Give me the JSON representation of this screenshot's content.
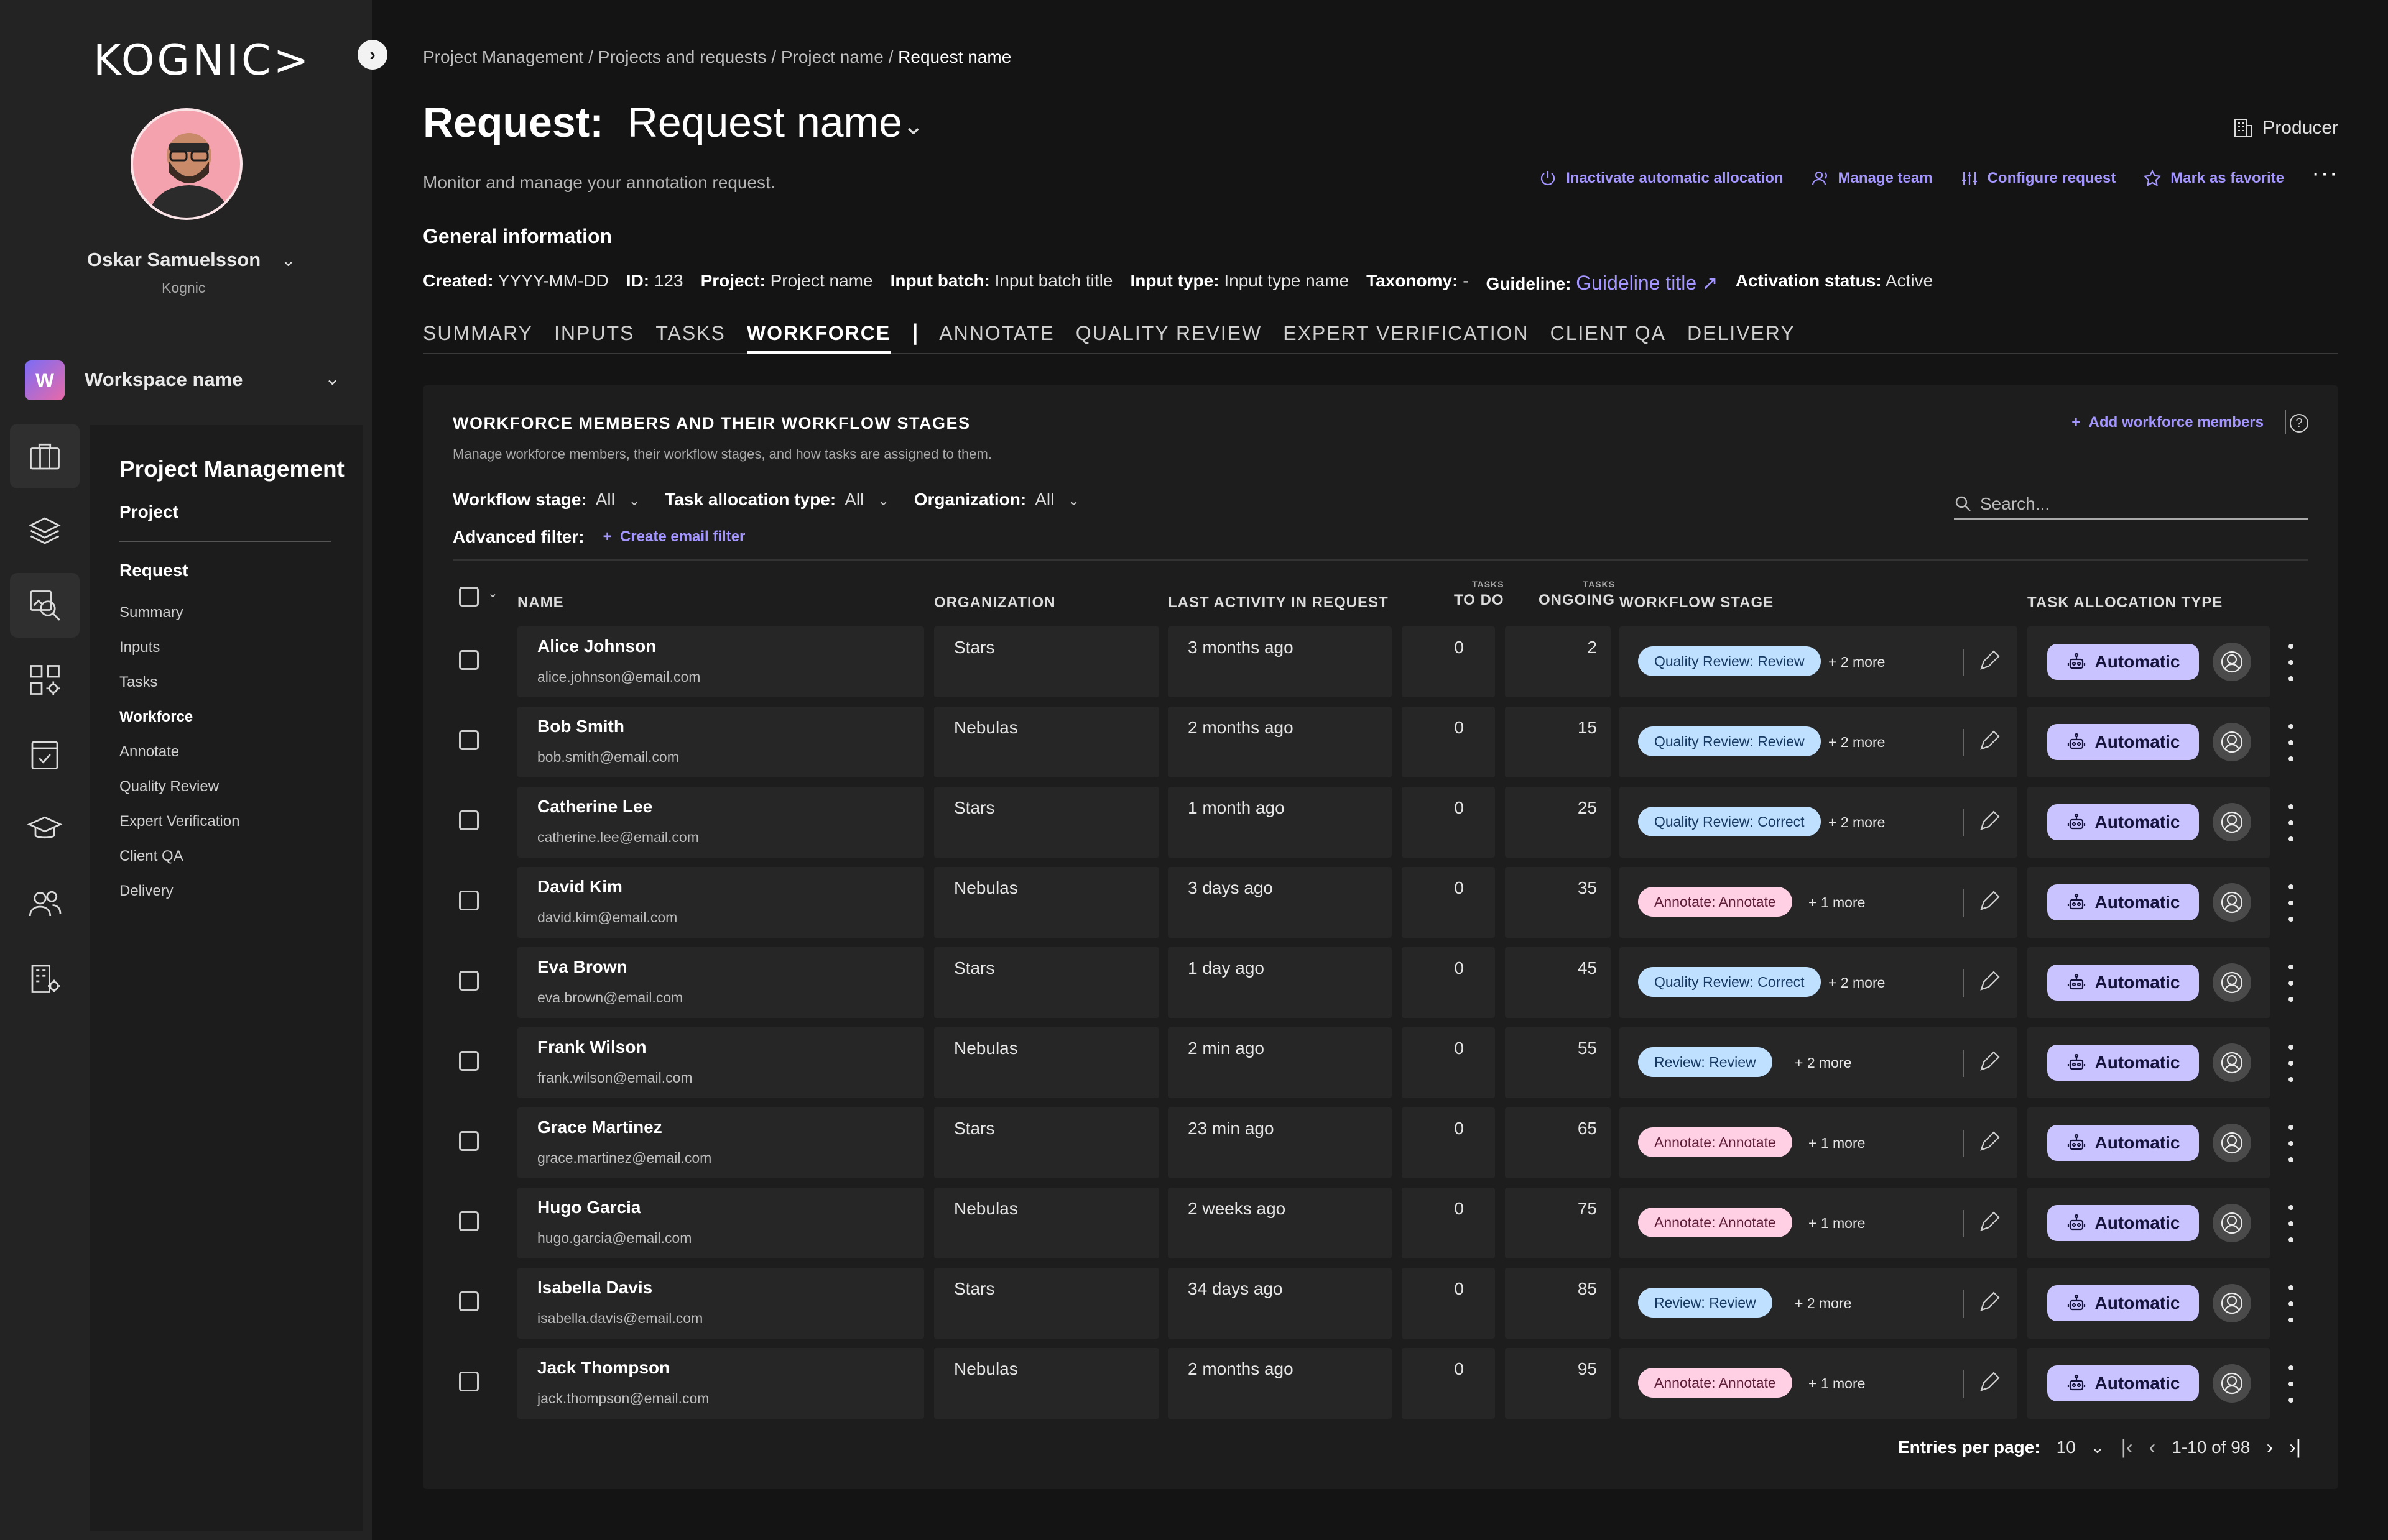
{
  "app": {
    "logo": "KOGNIC>"
  },
  "user": {
    "name": "Oskar Samuelsson",
    "org": "Kognic"
  },
  "workspace": {
    "badge": "W",
    "name": "Workspace name"
  },
  "rail_icons": [
    "briefcase-icon",
    "layers-icon",
    "search-image-icon",
    "apps-settings-icon",
    "checklist-icon",
    "graduation-cap-icon",
    "users-icon",
    "building-settings-icon"
  ],
  "subnav": {
    "title": "Project Management",
    "project": "Project",
    "request": "Request",
    "items": [
      {
        "label": "Summary",
        "active": false
      },
      {
        "label": "Inputs",
        "active": false
      },
      {
        "label": "Tasks",
        "active": false
      },
      {
        "label": "Workforce",
        "active": true
      },
      {
        "label": "Annotate",
        "active": false
      },
      {
        "label": "Quality Review",
        "active": false
      },
      {
        "label": "Expert Verification",
        "active": false
      },
      {
        "label": "Client QA",
        "active": false
      },
      {
        "label": "Delivery",
        "active": false
      }
    ]
  },
  "breadcrumb": {
    "items": [
      "Project Management",
      "Projects and requests",
      "Project name"
    ],
    "current": "Request name",
    "sep": " / "
  },
  "header": {
    "title_prefix": "Request:",
    "title": "Request name",
    "role": "Producer",
    "subtitle": "Monitor and manage your annotation request.",
    "actions": {
      "inactivate": "Inactivate automatic allocation",
      "manage_team": "Manage team",
      "configure": "Configure request",
      "favorite": "Mark as favorite"
    }
  },
  "general": {
    "title": "General information",
    "created_label": "Created:",
    "created": "YYYY-MM-DD",
    "id_label": "ID:",
    "id": "123",
    "project_label": "Project:",
    "project": "Project name",
    "batch_label": "Input batch:",
    "batch": "Input batch title",
    "type_label": "Input type:",
    "type": "Input type name",
    "taxonomy_label": "Taxonomy:",
    "taxonomy": "-",
    "guideline_label": "Guideline:",
    "guideline": "Guideline title",
    "status_label": "Activation status:",
    "status": "Active"
  },
  "tabs": {
    "summary": "SUMMARY",
    "inputs": "INPUTS",
    "tasks": "TASKS",
    "workforce": "WORKFORCE",
    "sep": "|",
    "annotate": "ANNOTATE",
    "quality_review": "QUALITY REVIEW",
    "expert_verification": "EXPERT VERIFICATION",
    "client_qa": "CLIENT QA",
    "delivery": "DELIVERY"
  },
  "card": {
    "title": "WORKFORCE MEMBERS AND THEIR WORKFLOW STAGES",
    "subtitle": "Manage workforce members, their workflow stages, and how tasks are assigned to them.",
    "add_members": "Add workforce members",
    "help": "?",
    "filters": {
      "stage_label": "Workflow stage:",
      "stage_value": "All",
      "alloc_label": "Task allocation type:",
      "alloc_value": "All",
      "org_label": "Organization:",
      "org_value": "All"
    },
    "search_placeholder": "Search...",
    "advanced_label": "Advanced filter:",
    "create_filter": "Create email filter"
  },
  "table": {
    "headers": {
      "name": "NAME",
      "organization": "ORGANIZATION",
      "last_activity": "LAST ACTIVITY IN REQUEST",
      "todo_super": "TASKS",
      "todo": "TO DO",
      "ongoing_super": "TASKS",
      "ongoing": "ONGOING",
      "stage": "WORKFLOW STAGE",
      "allocation": "TASK ALLOCATION TYPE"
    },
    "allocation_label": "Automatic",
    "rows": [
      {
        "name": "Alice Johnson",
        "email": "alice.johnson@email.com",
        "org": "Stars",
        "last": "3 months ago",
        "todo": "0",
        "ongoing": "2",
        "stage": "Quality Review: Review",
        "stage_kind": "qr",
        "more": "+ 2 more"
      },
      {
        "name": "Bob Smith",
        "email": "bob.smith@email.com",
        "org": "Nebulas",
        "last": "2 months ago",
        "todo": "0",
        "ongoing": "15",
        "stage": "Quality Review: Review",
        "stage_kind": "qr",
        "more": "+ 2 more"
      },
      {
        "name": "Catherine Lee",
        "email": "catherine.lee@email.com",
        "org": "Stars",
        "last": "1 month ago",
        "todo": "0",
        "ongoing": "25",
        "stage": "Quality Review: Correct",
        "stage_kind": "qr",
        "more": "+ 2 more"
      },
      {
        "name": "David Kim",
        "email": "david.kim@email.com",
        "org": "Nebulas",
        "last": "3 days ago",
        "todo": "0",
        "ongoing": "35",
        "stage": "Annotate: Annotate",
        "stage_kind": "an",
        "more": "+ 1 more"
      },
      {
        "name": "Eva Brown",
        "email": "eva.brown@email.com",
        "org": "Stars",
        "last": "1 day ago",
        "todo": "0",
        "ongoing": "45",
        "stage": "Quality Review: Correct",
        "stage_kind": "qr",
        "more": "+ 2 more"
      },
      {
        "name": "Frank Wilson",
        "email": "frank.wilson@email.com",
        "org": "Nebulas",
        "last": "2 min ago",
        "todo": "0",
        "ongoing": "55",
        "stage": "Review: Review",
        "stage_kind": "rv",
        "more": "+ 2 more"
      },
      {
        "name": "Grace Martinez",
        "email": "grace.martinez@email.com",
        "org": "Stars",
        "last": "23 min ago",
        "todo": "0",
        "ongoing": "65",
        "stage": "Annotate: Annotate",
        "stage_kind": "an",
        "more": "+ 1 more"
      },
      {
        "name": "Hugo Garcia",
        "email": "hugo.garcia@email.com",
        "org": "Nebulas",
        "last": "2 weeks ago",
        "todo": "0",
        "ongoing": "75",
        "stage": "Annotate: Annotate",
        "stage_kind": "an",
        "more": "+ 1 more"
      },
      {
        "name": "Isabella Davis",
        "email": "isabella.davis@email.com",
        "org": "Stars",
        "last": "34 days ago",
        "todo": "0",
        "ongoing": "85",
        "stage": "Review: Review",
        "stage_kind": "rv",
        "more": "+ 2 more"
      },
      {
        "name": "Jack Thompson",
        "email": "jack.thompson@email.com",
        "org": "Nebulas",
        "last": "2 months ago",
        "todo": "0",
        "ongoing": "95",
        "stage": "Annotate: Annotate",
        "stage_kind": "an",
        "more": "+ 1 more"
      }
    ]
  },
  "pagination": {
    "label": "Entries per page:",
    "per_page": "10",
    "range": "1-10 of 98"
  },
  "colors": {
    "accent": "#a496ff",
    "chip_blue": "#bfe0ff",
    "chip_pink": "#ffd0e3",
    "auto_chip": "#c9c3ff"
  }
}
